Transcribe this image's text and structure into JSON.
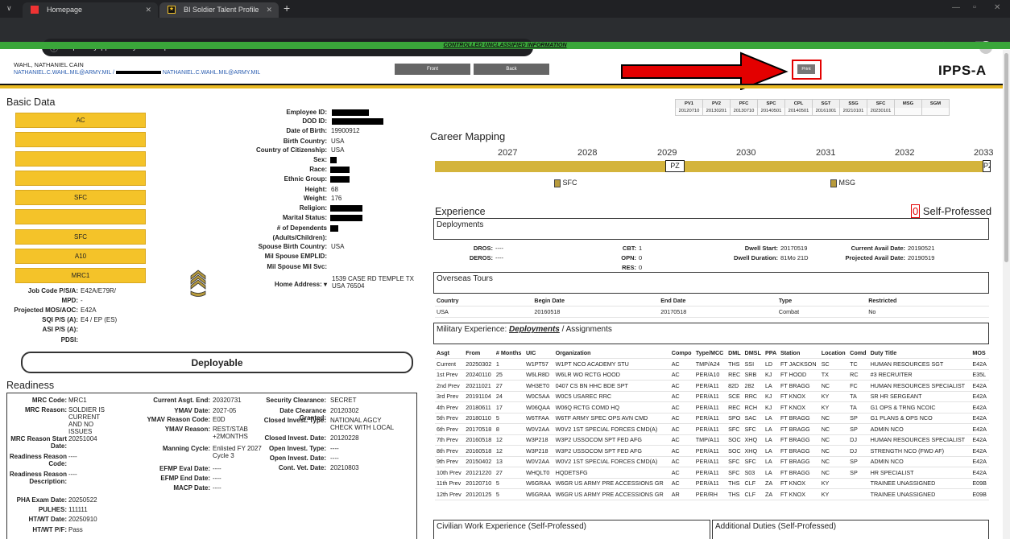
{
  "browser": {
    "tabs": [
      {
        "label": "Homepage",
        "active": false
      },
      {
        "label": "BI Soldier Talent Profile",
        "active": true
      }
    ],
    "url": "https://my.ippsa.army.mil/bi/stp/self/front",
    "new_tab": "+"
  },
  "banner": "CONTROLLED UNCLASSIFIED INFORMATION",
  "header": {
    "name": "WAHL, NATHANIEL CAIN",
    "email1": "NATHANIEL.C.WAHL.MIL@ARMY.MIL /",
    "email2": "NATHANIEL.C.WAHL.MIL@ARMY.MIL",
    "front_btn": "Front",
    "back_btn": "Back",
    "page_title_partial": "SC",
    "print_btn": "Print",
    "logo": "IPPS-A"
  },
  "basic_data": {
    "title": "Basic Data",
    "boxes": [
      "AC",
      "",
      "",
      "",
      "SFC",
      "",
      "SFC",
      "A10",
      "MRC1"
    ],
    "fields": [
      {
        "label": "Employee ID:",
        "value": "",
        "redacted": true
      },
      {
        "label": "DOD ID:",
        "value": "",
        "redacted": true
      },
      {
        "label": "Date of Birth:",
        "value": "19900912"
      },
      {
        "label": "Birth Country:",
        "value": "USA"
      },
      {
        "label": "Country of Citizenship:",
        "value": "USA"
      },
      {
        "label": "Sex:",
        "value": "",
        "redacted": true
      },
      {
        "label": "Race:",
        "value": "",
        "redacted": true
      },
      {
        "label": "Ethnic Group:",
        "value": "",
        "redacted": true
      },
      {
        "label": "Height:",
        "value": "68"
      },
      {
        "label": "Weight:",
        "value": "176"
      },
      {
        "label": "Religion:",
        "value": "",
        "redacted": true
      },
      {
        "label": "Marital Status:",
        "value": "",
        "redacted": true
      },
      {
        "label": "# of Dependents",
        "value": "",
        "redacted": true
      },
      {
        "label": "(Adults/Children):",
        "value": ""
      },
      {
        "label": "Spouse Birth Country:",
        "value": "USA"
      },
      {
        "label": "Mil Spouse EMPLID:",
        "value": ""
      },
      {
        "label": "Mil Spouse Mil Svc:",
        "value": ""
      }
    ],
    "home_address_label": "Home Address:",
    "home_address": [
      "1539 CASE RD TEMPLE TX",
      "USA 76504"
    ],
    "job_fields": [
      {
        "label": "Job Code P/S/A:",
        "value": "E42A/E79R/"
      },
      {
        "label": "MPD:",
        "value": "-"
      },
      {
        "label": "Projected MOS/AOC:",
        "value": "E42A"
      },
      {
        "label": "SQI P/S (A):",
        "value": "E4 / EP (ES)"
      },
      {
        "label": "ASI P/S (A):",
        "value": ""
      },
      {
        "label": "PDSI:",
        "value": ""
      }
    ],
    "deployable": "Deployable"
  },
  "readiness": {
    "title": "Readiness",
    "col1": [
      {
        "label": "MRC Code:",
        "value": "MRC1"
      },
      {
        "label": "MRC Reason:",
        "value": "SOLDIER IS CURRENT AND NO ISSUES"
      },
      {
        "label": "MRC Reason Start Date:",
        "value": "20251004"
      },
      {
        "label": "Readiness Reason Code:",
        "value": "----"
      },
      {
        "label": "Readiness Reason Description:",
        "value": "----"
      },
      {
        "label": "PHA Exam Date:",
        "value": "20250522"
      },
      {
        "label": "PULHES:",
        "value": "111111"
      },
      {
        "label": "HT/WT Date:",
        "value": "20250910"
      },
      {
        "label": "HT/WT P/F:",
        "value": "Pass"
      }
    ],
    "col2": [
      {
        "label": "Current Asgt. End:",
        "value": "20320731"
      },
      {
        "label": "YMAV Date:",
        "value": "2027-05"
      },
      {
        "label": "YMAV Reason Code:",
        "value": "E0D"
      },
      {
        "label": "YMAV Reason:",
        "value": "REST/STAB +2MONTHS"
      },
      {
        "label": "Manning Cycle:",
        "value": "Enlisted FY 2027 Cycle 3"
      },
      {
        "label": "EFMP Eval Date:",
        "value": "----"
      },
      {
        "label": "EFMP End Date:",
        "value": "----"
      },
      {
        "label": "MACP Date:",
        "value": "----"
      }
    ],
    "col3": [
      {
        "label": "Security Clearance:",
        "value": "SECRET"
      },
      {
        "label": "Date Clearance Granted:",
        "value": "20120302"
      },
      {
        "label": "Closed Invest. Type:",
        "value": "NATIONAL AGCY CHECK WITH LOCAL"
      },
      {
        "label": "Closed Invest. Date:",
        "value": "20120228"
      },
      {
        "label": "Open Invest. Type:",
        "value": "----"
      },
      {
        "label": "Open Invest. Date:",
        "value": "----"
      },
      {
        "label": "Cont. Vet. Date:",
        "value": "20210803"
      }
    ]
  },
  "ranks": {
    "headers": [
      "PV1",
      "PV2",
      "PFC",
      "SPC",
      "CPL",
      "SGT",
      "SSG",
      "SFC",
      "MSG",
      "SGM"
    ],
    "dates": [
      "20120710",
      "20130201",
      "20130710",
      "20140501",
      "20140501",
      "20161001",
      "20210101",
      "20230101",
      "",
      ""
    ]
  },
  "career": {
    "title": "Career Mapping",
    "years": [
      "2027",
      "2028",
      "2029",
      "2030",
      "2031",
      "2032",
      "2033"
    ],
    "pz": "PZ",
    "pz2": "PZ",
    "sfc": "SFC",
    "msg": "MSG"
  },
  "experience": {
    "title": "Experience",
    "self_count": "0",
    "self_label": "Self-Professed",
    "deployments_title": "Deployments",
    "dep": [
      {
        "label": "DROS:",
        "value": "----"
      },
      {
        "label": "DEROS:",
        "value": "----"
      },
      {
        "label": "CBT:",
        "value": "1"
      },
      {
        "label": "OPN:",
        "value": "0"
      },
      {
        "label": "RES:",
        "value": "0"
      },
      {
        "label": "Dwell Start:",
        "value": "20170519"
      },
      {
        "label": "Dwell Duration:",
        "value": "81Mo 21D"
      },
      {
        "label": "Current Avail Date:",
        "value": "20190521"
      },
      {
        "label": "Projected Avail Date:",
        "value": "20190519"
      }
    ],
    "overseas_title": "Overseas Tours",
    "overseas_headers": [
      "Country",
      "Begin Date",
      "End Date",
      "Type",
      "Restricted"
    ],
    "overseas_row": [
      "USA",
      "20160518",
      "20170518",
      "Combat",
      "No"
    ],
    "milexp_label": "Military Experience:",
    "milexp_dep": "Deployments",
    "milexp_sep": "/",
    "milexp_asg": "Assignments",
    "asg_headers": [
      "Asgt",
      "From",
      "# Months",
      "UIC",
      "Organization",
      "Compo",
      "Type/MCC",
      "DML",
      "DMSL",
      "PPA",
      "Station",
      "Location",
      "Comd",
      "Duty Title",
      "MOS"
    ],
    "asg_rows": [
      [
        "Current",
        "20250302",
        "1",
        "W1PT57",
        "W1PT NCO ACADEMY STU",
        "AC",
        "TMP/A24",
        "THS",
        "SSI",
        "LD",
        "FT JACKSON",
        "SC",
        "TC",
        "HUMAN RESOURCES SGT",
        "E42A"
      ],
      [
        "1st Prev",
        "20240110",
        "25",
        "W6LR8D",
        "W6LR WO RCTG HOOD",
        "AC",
        "PER/A10",
        "REC",
        "SRB",
        "KJ",
        "FT HOOD",
        "TX",
        "RC",
        "#3 RECRUITER",
        "E35L"
      ],
      [
        "2nd Prev",
        "20211021",
        "27",
        "WH3ET0",
        "0407 CS BN    HHC BDE SPT",
        "AC",
        "PER/A11",
        "82D",
        "282",
        "LA",
        "FT BRAGG",
        "NC",
        "FC",
        "HUMAN RESOURCES SPECIALIST",
        "E42A"
      ],
      [
        "3rd Prev",
        "20191104",
        "24",
        "W0C5AA",
        "W0C5  USAREC RRC",
        "AC",
        "PER/A11",
        "SCE",
        "RRC",
        "KJ",
        "FT KNOX",
        "KY",
        "TA",
        "SR HR SERGEANT",
        "E42A"
      ],
      [
        "4th Prev",
        "20180611",
        "17",
        "W06QAA",
        "W06Q RCTG COMD HQ",
        "AC",
        "PER/A11",
        "REC",
        "RCH",
        "KJ",
        "FT KNOX",
        "KY",
        "TA",
        "G1 OPS & TRNG NCOIC",
        "E42A"
      ],
      [
        "5th Prev",
        "20180110",
        "5",
        "W6TFAA",
        "W6TF ARMY SPEC OPS AVN CMD",
        "AC",
        "PER/A11",
        "SPO",
        "SAC",
        "LA",
        "FT BRAGG",
        "NC",
        "SP",
        "G1 PLANS & OPS NCO",
        "E42A"
      ],
      [
        "6th Prev",
        "20170518",
        "8",
        "W0V2AA",
        "W0V2 1ST SPECIAL FORCES CMD(A)",
        "AC",
        "PER/A11",
        "SFC",
        "SFC",
        "LA",
        "FT BRAGG",
        "NC",
        "SP",
        "ADMIN NCO",
        "E42A"
      ],
      [
        "7th Prev",
        "20160518",
        "12",
        "W3P218",
        "W3P2 USSOCOM SPT FED AFG",
        "AC",
        "TMP/A11",
        "SOC",
        "XHQ",
        "LA",
        "FT BRAGG",
        "NC",
        "DJ",
        "HUMAN RESOURCES SPECIALIST",
        "E42A"
      ],
      [
        "8th Prev",
        "20160518",
        "12",
        "W3P218",
        "W3P2 USSOCOM SPT FED AFG",
        "AC",
        "PER/A11",
        "SOC",
        "XHQ",
        "LA",
        "FT BRAGG",
        "NC",
        "DJ",
        "STRENGTH NCO (FWD AF)",
        "E42A"
      ],
      [
        "9th Prev",
        "20150402",
        "13",
        "W0V2AA",
        "W0V2 1ST SPECIAL FORCES CMD(A)",
        "AC",
        "PER/A11",
        "SFC",
        "SFC",
        "LA",
        "FT BRAGG",
        "NC",
        "SP",
        "ADMIN NCO",
        "E42A"
      ],
      [
        "10th Prev",
        "20121220",
        "27",
        "WHQLT0",
        "HQDETSFG",
        "AC",
        "PER/A11",
        "SFC",
        "S03",
        "LA",
        "FT BRAGG",
        "NC",
        "SP",
        "HR SPECIALIST",
        "E42A"
      ],
      [
        "11th Prev",
        "20120710",
        "5",
        "W6GRAA",
        "W6GR US ARMY PRE ACCESSIONS GR",
        "AC",
        "PER/A11",
        "THS",
        "CLF",
        "ZA",
        "FT KNOX",
        "KY",
        "",
        "TRAINEE UNASSIGNED",
        "E09B"
      ],
      [
        "12th Prev",
        "20120125",
        "5",
        "W6GRAA",
        "W6GR US ARMY PRE ACCESSIONS GR",
        "AR",
        "PER/RH",
        "THS",
        "CLF",
        "ZA",
        "FT KNOX",
        "KY",
        "",
        "TRAINEE UNASSIGNED",
        "E09B"
      ]
    ],
    "civilian_title": "Civilian Work Experience (Self-Professed)",
    "additional_title": "Additional Duties (Self-Professed)"
  },
  "colors": {
    "gold": "#f4c329",
    "arrow": "#e30000",
    "cui_green": "#3aa63a"
  }
}
